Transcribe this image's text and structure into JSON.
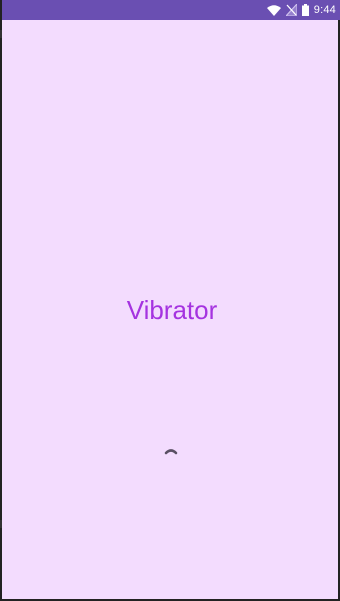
{
  "status_bar": {
    "time": "9:44",
    "icons": [
      "wifi-icon",
      "no-signal-icon",
      "battery-icon"
    ],
    "background_color": "#6a4fb2"
  },
  "main": {
    "title": "Vibrator",
    "title_color": "#a533e0",
    "background_color": "#f3dcfe",
    "loading": true
  }
}
